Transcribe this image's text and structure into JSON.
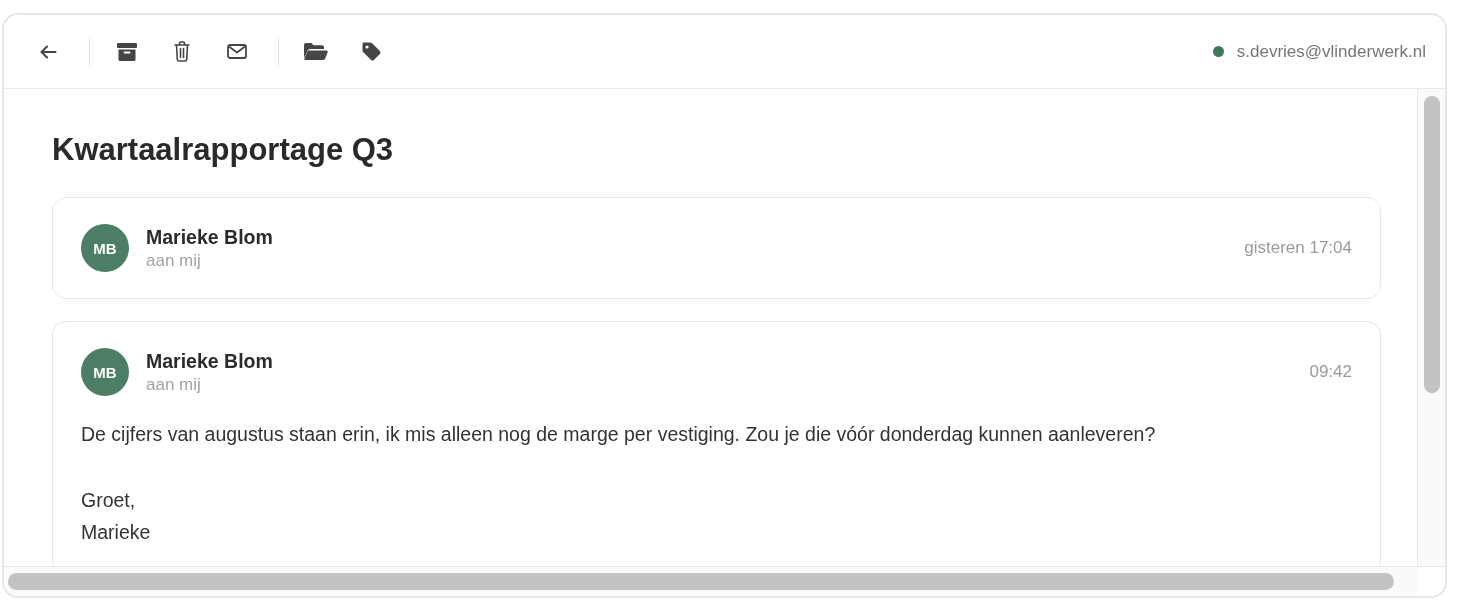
{
  "toolbar": {
    "account": {
      "email": "s.devries@vlinderwerk.nl",
      "online": true
    }
  },
  "subject": "Kwartaalrapportage Q3",
  "messages": [
    {
      "initials": "MB",
      "sender": "Marieke Blom",
      "recipient": "aan mij",
      "time": "gisteren 17:04",
      "expanded": false
    },
    {
      "initials": "MB",
      "sender": "Marieke Blom",
      "recipient": "aan mij",
      "time": "09:42",
      "expanded": true,
      "paragraphs": [
        "De cijfers van augustus staan erin, ik mis alleen nog de marge per vestiging. Zou je die vóór donderdag kunnen aanleveren?",
        "Groet,\nMarieke"
      ]
    }
  ]
}
